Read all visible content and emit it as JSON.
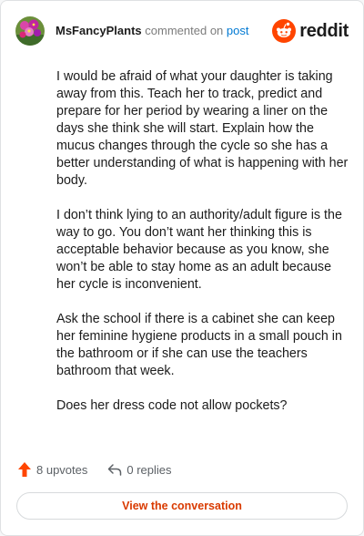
{
  "header": {
    "username": "MsFancyPlants",
    "commented_text": "commented on",
    "post_link": "post",
    "brand": "reddit",
    "avatar_icon": "flower-avatar-icon",
    "logo_icon": "reddit-snoo-icon"
  },
  "comment": {
    "paragraphs": [
      "I would be afraid of what your daughter is taking away from this. Teach her to track, predict and prepare for her period by wearing a liner on the days she think she will start. Explain how the mucus changes through the cycle so she has a better understanding of what is happening with her body.",
      "I don’t think lying to an authority/adult figure is the way to go. You don’t want her thinking this is acceptable behavior because as you know, she won’t be able to stay home as an adult because her cycle is inconvenient.",
      "Ask the school if there is a cabinet she can keep her feminine hygiene products in a small pouch in the bathroom or if she can use the teachers bathroom that week.",
      "Does her dress code not allow pockets?"
    ]
  },
  "actions": {
    "upvotes": "8 upvotes",
    "replies": "0 replies",
    "upvote_icon": "upvote-arrow-icon",
    "reply_icon": "reply-arrow-icon"
  },
  "cta": {
    "label": "View the conversation"
  },
  "colors": {
    "accent": "#d93a00",
    "reddit_orange": "#ff4500",
    "link_blue": "#0079d3"
  }
}
